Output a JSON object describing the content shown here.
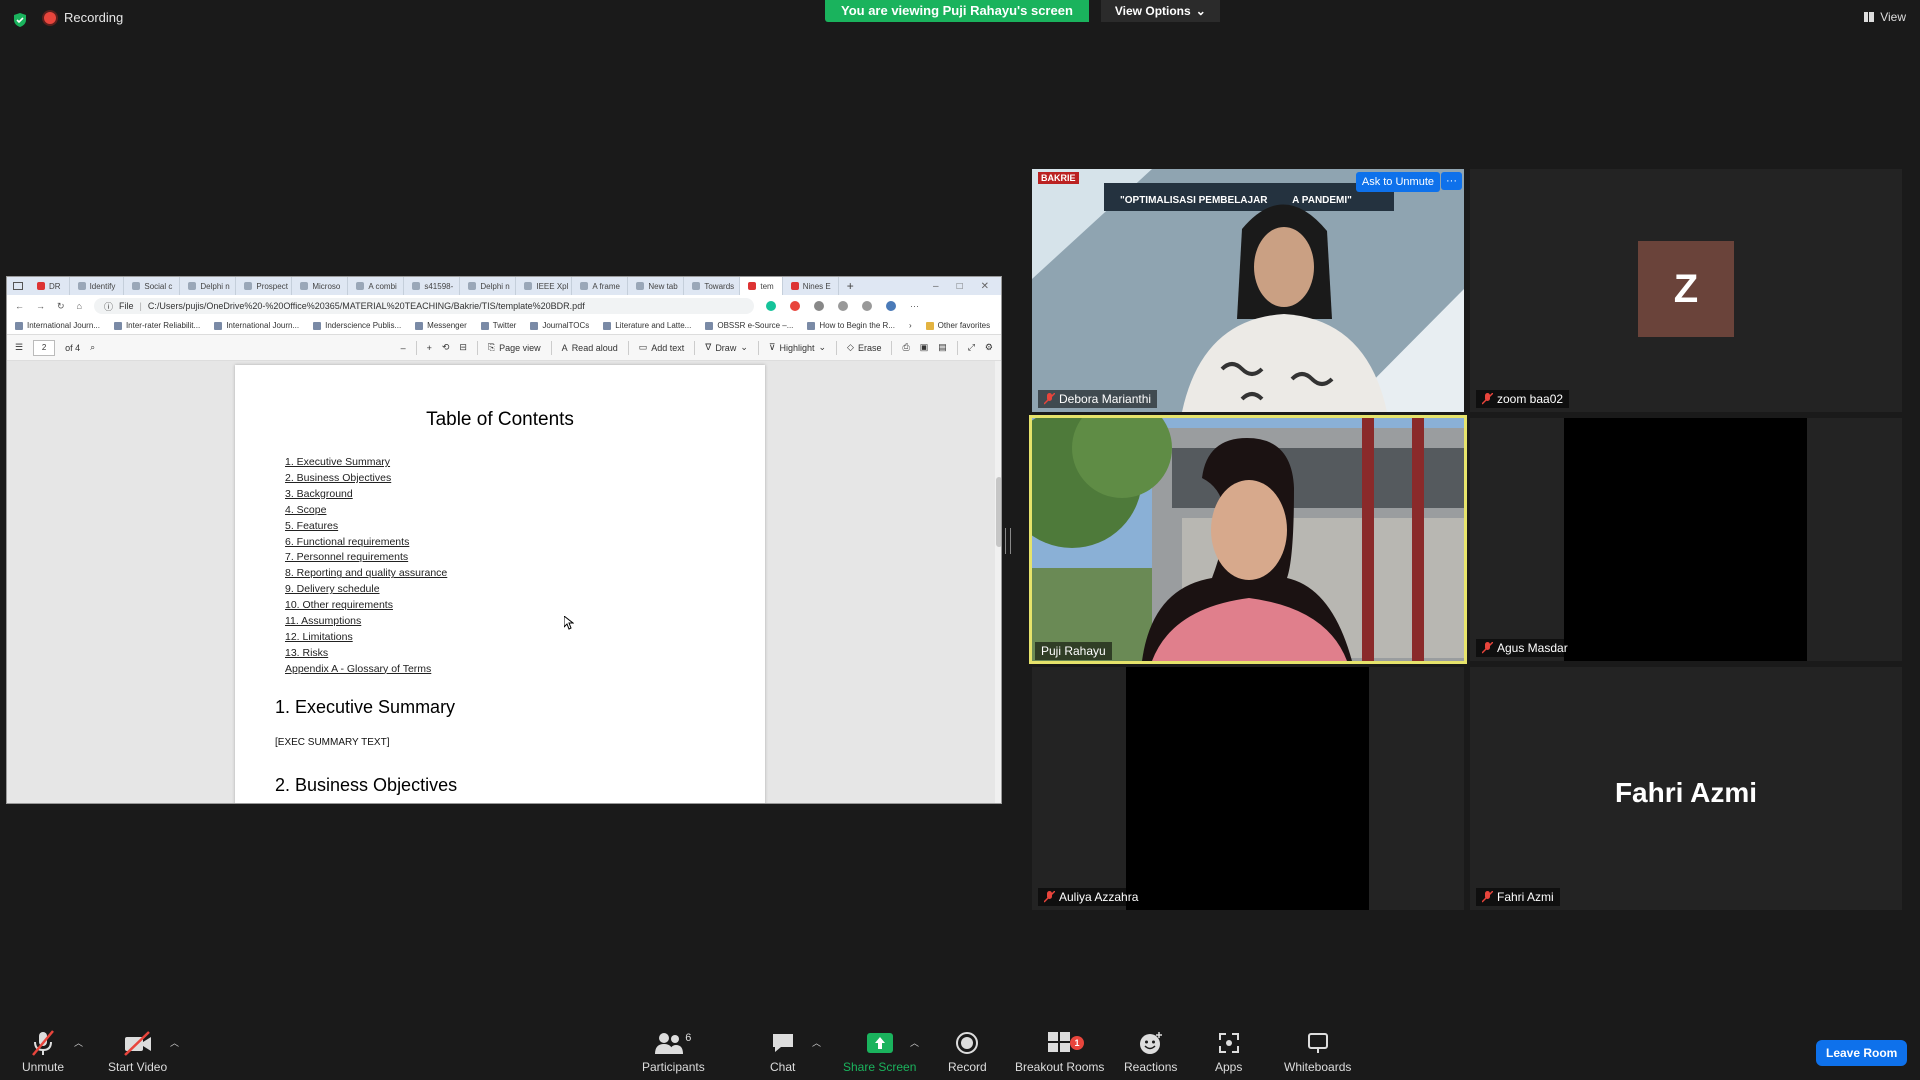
{
  "top": {
    "recording": "Recording",
    "banner": "You are viewing Puji Rahayu's screen",
    "view_options": "View Options",
    "view": "View"
  },
  "browser": {
    "tabs": [
      "DR",
      "Identify",
      "Social c",
      "Delphi n",
      "Prospect",
      "Microso",
      "A combi",
      "s41598-",
      "Delphi n",
      "IEEE Xpl",
      "A frame",
      "New tab",
      "Towards",
      "tem",
      "Nines E"
    ],
    "url_prefix": "File",
    "url": "C:/Users/pujis/OneDrive%20-%20Office%20365/MATERIAL%20TEACHING/Bakrie/TIS/template%20BDR.pdf",
    "favorites": [
      "International Journ...",
      "Inter-rater Reliabilit...",
      "International Journ...",
      "Inderscience Publis...",
      "Messenger",
      "Twitter",
      "JournalTOCs",
      "Literature and Latte...",
      "OBSSR e-Source –...",
      "How to Begin the R..."
    ],
    "other_favorites": "Other favorites"
  },
  "pdf_toolbar": {
    "page": "2",
    "of": "of 4",
    "page_view": "Page view",
    "read_aloud": "Read aloud",
    "add_text": "Add text",
    "draw": "Draw",
    "highlight": "Highlight",
    "erase": "Erase"
  },
  "document": {
    "title": "Table of Contents",
    "toc": [
      "1. Executive Summary",
      "2. Business Objectives",
      "3. Background",
      "4. Scope",
      "5. Features",
      "6. Functional requirements",
      "7. Personnel requirements",
      "8. Reporting and quality assurance",
      "9. Delivery schedule",
      "10. Other requirements",
      "11. Assumptions",
      "12. Limitations",
      "13. Risks",
      "Appendix A - Glossary of Terms"
    ],
    "section1": "1. Executive Summary",
    "exec_text": "[EXEC SUMMARY TEXT]",
    "section2": "2. Business Objectives"
  },
  "tiles": {
    "debora": "Debora Marianthi",
    "ask_unmute": "Ask to Unmute",
    "more": "···",
    "zoom": "zoom baa02",
    "zoom_initial": "Z",
    "puji": "Puji Rahayu",
    "agus": "Agus Masdar",
    "auliya": "Auliya Azzahra",
    "fahri_big": "Fahri Azmi",
    "fahri": "Fahri Azmi",
    "banner_text": "\"OPTIMALISASI PEMBELAJAR         A PANDEMI\"",
    "logo_text": "BAKRIE"
  },
  "toolbar": {
    "unmute": "Unmute",
    "start_video": "Start Video",
    "participants": "Participants",
    "participants_count": "6",
    "chat": "Chat",
    "share": "Share Screen",
    "record": "Record",
    "breakout": "Breakout Rooms",
    "breakout_badge": "1",
    "reactions": "Reactions",
    "apps": "Apps",
    "whiteboards": "Whiteboards",
    "leave": "Leave Room"
  },
  "colors": {
    "share_green": "#1ab35d",
    "leave_blue": "#0e71eb",
    "speaker_border": "#e6e36b"
  }
}
